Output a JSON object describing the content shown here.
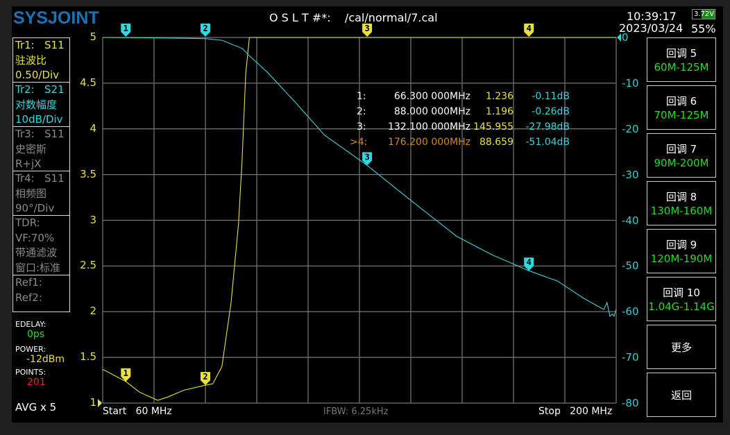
{
  "header": {
    "logo": "SYSJOINT",
    "cal_label": "O S L T #*:",
    "cal_file": "/cal/normal/7.cal",
    "time": "10:39:17",
    "date": "2023/03/24",
    "battery_voltage": "3.72V",
    "battery_percent": "55%"
  },
  "traces": [
    {
      "line1": "Tr1:   S11",
      "line2": "驻波比",
      "line3": "0.50/Div",
      "color": "#e8e040"
    },
    {
      "line1": "Tr2:   S21",
      "line2": "对数幅度",
      "line3": "10dB/Div",
      "color": "#30d8e0"
    },
    {
      "line1": "Tr3:   S11",
      "line2": "史密斯",
      "line3": "R+jX",
      "color": "#8a8a8a"
    },
    {
      "line1": "Tr4:   S11",
      "line2": "相频图",
      "line3": "90°/Div",
      "color": "#8a8a8a"
    }
  ],
  "tdr": {
    "line1": "TDR:",
    "line2": "VF:70%",
    "line3": "带通滤波",
    "line4": "窗口:标准"
  },
  "refs": {
    "ref1": "Ref1:",
    "ref2": "Ref2:"
  },
  "status": {
    "edelay_label": "EDELAY:",
    "edelay": "0ps",
    "power_label": "POWER:",
    "power": "-12dBm",
    "points_label": "POINTS:",
    "points": "201",
    "avg": "AVG x 5"
  },
  "footer": {
    "start": "Start   60 MHz",
    "ifbw": "IFBW: 6.25kHz",
    "stop": "Stop   200 MHz"
  },
  "markers": [
    {
      "label": "1:",
      "freq": "66.300 000MHz",
      "vswr": "1.236",
      "db": "-0.11dB",
      "active": false
    },
    {
      "label": "2:",
      "freq": "88.000 000MHz",
      "vswr": "1.196",
      "db": "-0.26dB",
      "active": false
    },
    {
      "label": "3:",
      "freq": "132.100 000MHz",
      "vswr": "145.955",
      "db": "-27.98dB",
      "active": false
    },
    {
      "label": ">4:",
      "freq": "176.200 000MHz",
      "vswr": "88.659",
      "db": "-51.04dB",
      "active": true
    }
  ],
  "buttons": [
    {
      "title": "回调 5",
      "range": "60M-125M"
    },
    {
      "title": "回调 6",
      "range": "70M-125M"
    },
    {
      "title": "回调 7",
      "range": "90M-200M"
    },
    {
      "title": "回调 8",
      "range": "130M-160M"
    },
    {
      "title": "回调 9",
      "range": "120M-190M"
    },
    {
      "title": "回调 10",
      "range": "1.04G-1.14G"
    },
    {
      "title": "更多"
    },
    {
      "title": "返回"
    }
  ],
  "chart_data": {
    "type": "line",
    "x_range_mhz": [
      60,
      200
    ],
    "x_divisions": 10,
    "left_axis": {
      "ticks": [
        "5",
        "4.5",
        "4",
        "3.5",
        "3",
        "2.5",
        "2",
        "1.5",
        "1"
      ],
      "range": [
        1,
        5
      ]
    },
    "right_axis": {
      "ticks": [
        "0",
        "-10",
        "-20",
        "-30",
        "-40",
        "-50",
        "-60",
        "-70",
        "-80"
      ],
      "range": [
        -80,
        0
      ]
    },
    "series": [
      {
        "name": "S11 VSWR",
        "axis": "left",
        "color": "#e8e040",
        "x": [
          60,
          66.3,
          70,
          75,
          78,
          82,
          88,
          90,
          92.5,
          95,
          97,
          98,
          99,
          100,
          200
        ],
        "y": [
          1.37,
          1.236,
          1.12,
          1.03,
          1.07,
          1.14,
          1.196,
          1.21,
          1.4,
          2.1,
          2.95,
          3.66,
          4.6,
          5,
          5
        ]
      },
      {
        "name": "S21 LogMag",
        "axis": "right",
        "color": "#40d0d8",
        "x": [
          60,
          75,
          88,
          92.5,
          98,
          100,
          105,
          113,
          120.5,
          132.1,
          143,
          156.5,
          166,
          176.2,
          184,
          191,
          196.6,
          197.5,
          198.3,
          199,
          199.4,
          200
        ],
        "y": [
          0,
          -0.1,
          -0.26,
          -0.6,
          -2.4,
          -4,
          -7.7,
          -14.6,
          -21.4,
          -27.98,
          -35,
          -43.5,
          -47.5,
          -51.04,
          -53.3,
          -57,
          -59.5,
          -58,
          -61,
          -60.5,
          -61,
          -59.5
        ]
      }
    ],
    "markers": [
      {
        "id": "1",
        "freq": 66.3
      },
      {
        "id": "2",
        "freq": 88.0
      },
      {
        "id": "3",
        "freq": 132.1
      },
      {
        "id": "4",
        "freq": 176.2
      }
    ]
  }
}
